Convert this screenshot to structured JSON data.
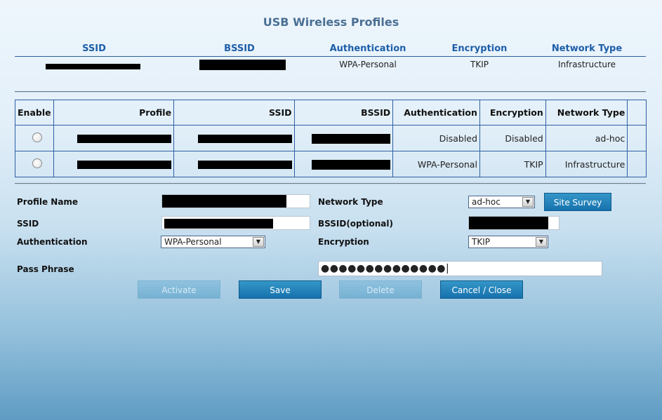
{
  "title": "USB Wireless Profiles",
  "info": {
    "headers": [
      "SSID",
      "BSSID",
      "Authentication",
      "Encryption",
      "Network Type"
    ],
    "row": {
      "authentication": "WPA-Personal",
      "encryption": "TKIP",
      "network_type": "Infrastructure"
    }
  },
  "profiles": {
    "headers": [
      "Enable",
      "Profile",
      "SSID",
      "BSSID",
      "Authentication",
      "Encryption",
      "Network Type"
    ],
    "rows": [
      {
        "authentication": "Disabled",
        "encryption": "Disabled",
        "network_type": "ad-hoc"
      },
      {
        "authentication": "WPA-Personal",
        "encryption": "TKIP",
        "network_type": "Infrastructure"
      }
    ]
  },
  "form": {
    "profile_name_label": "Profile Name",
    "ssid_label": "SSID",
    "authentication_label": "Authentication",
    "pass_phrase_label": "Pass Phrase",
    "network_type_label": "Network Type",
    "bssid_label": "BSSID(optional)",
    "encryption_label": "Encryption",
    "network_type_value": "ad-hoc",
    "authentication_value": "WPA-Personal",
    "encryption_value": "TKIP",
    "pass_phrase_value": "●●●●●●●●●●●●●●|"
  },
  "buttons": {
    "site_survey": "Site Survey",
    "activate": "Activate",
    "save": "Save",
    "delete": "Delete",
    "cancel_close": "Cancel / Close"
  }
}
